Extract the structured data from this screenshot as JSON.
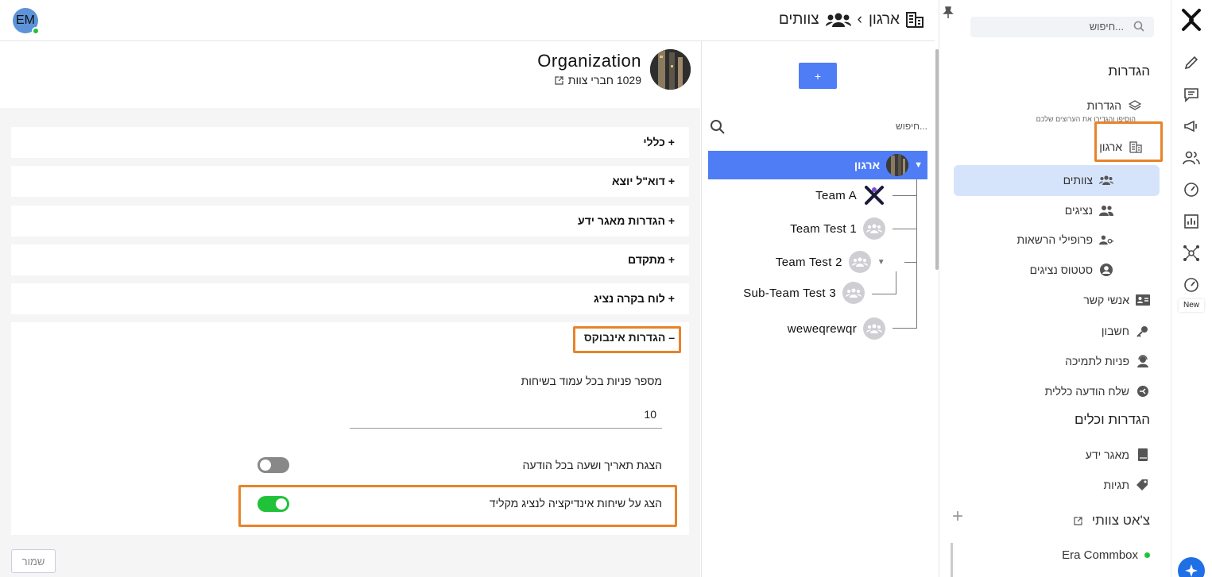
{
  "colors": {
    "accent": "#4f7df5",
    "active_bg": "#d6e4fb",
    "highlight": "#e8832a",
    "toggle_on": "#21c23a",
    "toggle_off": "#888888"
  },
  "rail": {
    "icons": [
      "logo-icon",
      "pencil-icon",
      "chat-icon",
      "megaphone-icon",
      "users-icon",
      "gauge-icon",
      "bar-chart-icon",
      "network-icon",
      "gauge-new-icon"
    ],
    "new_label": "New"
  },
  "sidebar": {
    "search_placeholder": "חיפוש...",
    "section_settings": "הגדרות",
    "settings_item": "הגדרות",
    "settings_sub": "הוסיפו והגדירו את הערוצים שלכם",
    "org_item": "ארגון",
    "items": [
      {
        "label": "צוותים",
        "icon": "teams-icon"
      },
      {
        "label": "נציגים",
        "icon": "agents-icon"
      },
      {
        "label": "פרופילי הרשאות",
        "icon": "permission-profiles-icon"
      },
      {
        "label": "סטטוס נציגים",
        "icon": "agent-status-icon"
      },
      {
        "label": "אנשי קשר",
        "icon": "contacts-icon"
      },
      {
        "label": "חשבון",
        "icon": "account-icon"
      },
      {
        "label": "פניות לתמיכה",
        "icon": "support-icon"
      },
      {
        "label": "שלח הודעה כללית",
        "icon": "broadcast-icon"
      }
    ],
    "section_tools": "הגדרות וכלים",
    "tools": [
      {
        "label": "מאגר ידע",
        "icon": "book-icon"
      },
      {
        "label": "תגיות",
        "icon": "tags-icon"
      }
    ],
    "section_team_chat": "צ'אט צוותי",
    "chat_item": "Era Commbox"
  },
  "header": {
    "avatar_initials": "EM",
    "crumb_org": "ארגון",
    "crumb_sep": "›",
    "crumb_teams": "צוותים"
  },
  "tree": {
    "add_label": "+",
    "search_placeholder": "חיפוש...",
    "root_label": "ארגון",
    "teams": [
      {
        "name": "Team A"
      },
      {
        "name": "Team Test 1"
      },
      {
        "name": "Team Test 2"
      },
      {
        "name": "Sub-Team Test 3"
      },
      {
        "name": "weweqrewqr"
      }
    ]
  },
  "org": {
    "title": "Organization",
    "members": "1029 חברי צוות"
  },
  "accordions": [
    {
      "label": "+ כללי"
    },
    {
      "label": "+ דוא\"ל יוצא"
    },
    {
      "label": "+ הגדרות מאגר ידע"
    },
    {
      "label": "+ מתקדם"
    },
    {
      "label": "+ לוח בקרה נציג"
    }
  ],
  "inbox": {
    "label": "– הגדרות אינבוקס",
    "per_page_label": "מספר פניות בכל עמוד בשיחות",
    "per_page_value": "10",
    "show_date_label": "הצגת תאריך ושעה בכל הודעה",
    "show_date_on": false,
    "typing_label": "הצג על שיחות אינדיקציה לנציג מקליד",
    "typing_on": true
  },
  "save_label": "שמור"
}
